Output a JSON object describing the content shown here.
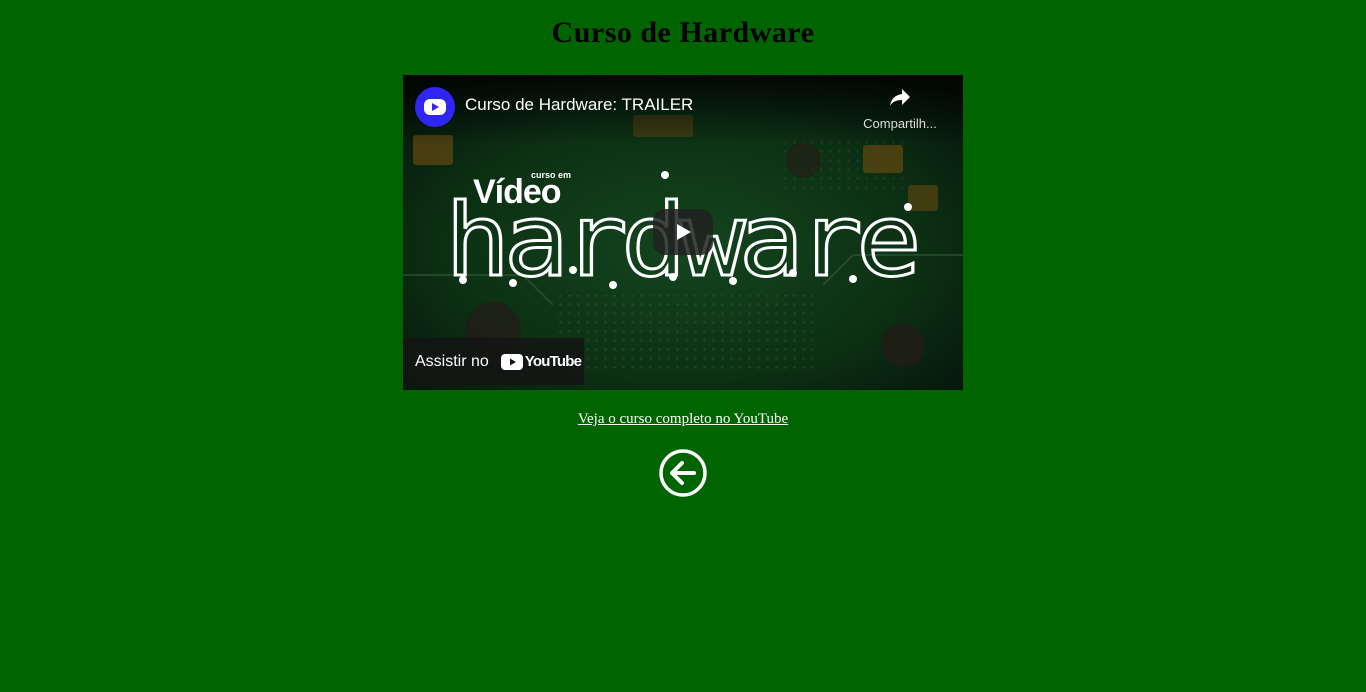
{
  "page": {
    "title": "Curso de Hardware",
    "background_color": "#006400"
  },
  "video": {
    "title": "Curso de Hardware: TRAILER",
    "share_label": "Compartilh...",
    "watch_on_label": "Assistir no",
    "youtube_logo_text": "YouTube",
    "thumbnail_brand_top": "curso em",
    "thumbnail_brand": "Vídeo",
    "thumbnail_word": "hardware",
    "channel_avatar_color": "#2f25f5",
    "icons": [
      "channel-avatar-icon",
      "share-icon",
      "play-icon",
      "youtube-logo-icon"
    ]
  },
  "links": {
    "full_course": "Veja o curso completo no YouTube"
  },
  "nav": {
    "back_icon": "arrow-left-circle-icon"
  }
}
